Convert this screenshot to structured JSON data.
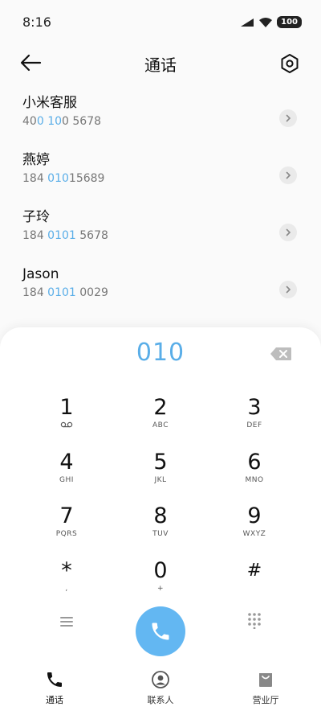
{
  "status_bar": {
    "time": "8:16",
    "battery": "100"
  },
  "header": {
    "title": "通话"
  },
  "contacts": [
    {
      "name": "小米客服",
      "number_parts": [
        "40",
        "0",
        " ",
        "10",
        "0 5678"
      ]
    },
    {
      "name": "燕婷",
      "number_parts": [
        "184 ",
        "010",
        "15689",
        "",
        ""
      ]
    },
    {
      "name": "子玲",
      "number_parts": [
        "184 ",
        "0101",
        " 5678",
        "",
        ""
      ]
    },
    {
      "name": "Jason",
      "number_parts": [
        "184 ",
        "0101",
        " 0029",
        "",
        ""
      ]
    }
  ],
  "dialpad": {
    "display": "010",
    "keys": [
      {
        "digit": "1",
        "letters": ""
      },
      {
        "digit": "2",
        "letters": "ABC"
      },
      {
        "digit": "3",
        "letters": "DEF"
      },
      {
        "digit": "4",
        "letters": "GHI"
      },
      {
        "digit": "5",
        "letters": "JKL"
      },
      {
        "digit": "6",
        "letters": "MNO"
      },
      {
        "digit": "7",
        "letters": "PQRS"
      },
      {
        "digit": "8",
        "letters": "TUV"
      },
      {
        "digit": "9",
        "letters": "WXYZ"
      },
      {
        "digit": "*",
        "letters": ","
      },
      {
        "digit": "0",
        "letters": "+"
      },
      {
        "digit": "#",
        "letters": ""
      }
    ]
  },
  "bottom_nav": {
    "items": [
      {
        "label": "通话",
        "active": true
      },
      {
        "label": "联系人",
        "active": false
      },
      {
        "label": "营业厅",
        "active": false
      }
    ]
  },
  "colors": {
    "accent": "#5aaee8",
    "call_button": "#63b7f2"
  }
}
